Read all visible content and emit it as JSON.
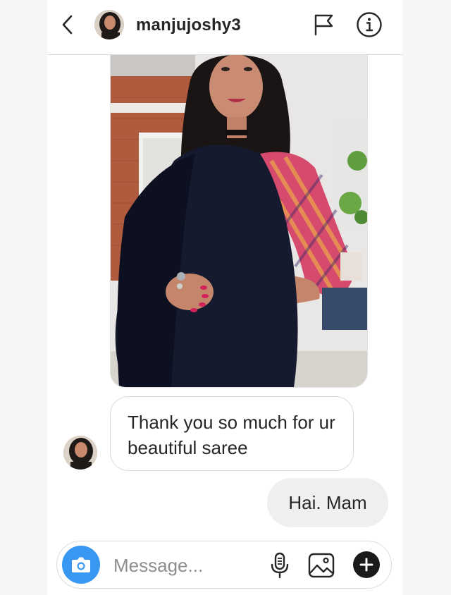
{
  "header": {
    "username": "manjujoshy3",
    "icons": [
      "back-chevron-icon",
      "flag-icon",
      "info-icon"
    ]
  },
  "messages": {
    "photo": {
      "kind": "photo",
      "subject": "woman-in-black-saree"
    },
    "received_text": "Thank you so much for ur beautiful saree",
    "sent_text": "Hai. Mam"
  },
  "composer": {
    "placeholder": "Message...",
    "icons": [
      "camera-icon",
      "microphone-icon",
      "gallery-icon",
      "plus-icon"
    ]
  },
  "colors": {
    "accent_blue": "#3897f0",
    "sent_bubble_bg": "#efefef",
    "border": "#dbdbdb",
    "text": "#262626",
    "placeholder": "#8e8e8e"
  }
}
